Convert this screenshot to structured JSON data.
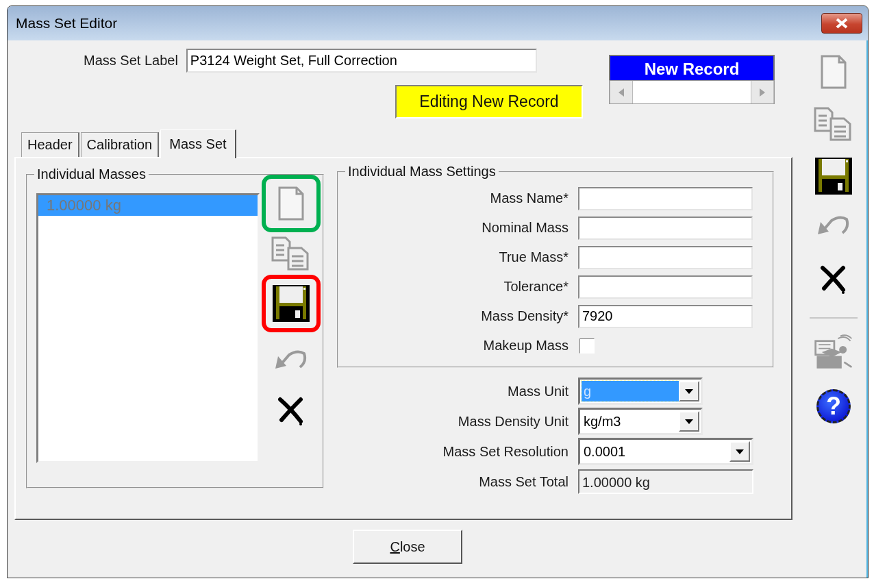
{
  "window": {
    "title": "Mass Set Editor"
  },
  "mass_set_label": {
    "label": "Mass Set Label",
    "value": "P3124 Weight Set, Full Correction"
  },
  "edit_status": "Editing New Record",
  "record_navigator": {
    "label": "New Record"
  },
  "tabs": [
    {
      "label": "Header",
      "selected": false
    },
    {
      "label": "Calibration",
      "selected": false
    },
    {
      "label": "Mass Set",
      "selected": true
    }
  ],
  "individual_masses": {
    "title": "Individual Masses",
    "items": [
      {
        "label": "1.00000 kg",
        "selected": true
      }
    ],
    "toolbar": [
      {
        "kind": "new",
        "disabled": true,
        "color": "#00b050"
      },
      {
        "kind": "copy",
        "disabled": true
      },
      {
        "kind": "save",
        "disabled": false,
        "color": "#ff0000"
      },
      {
        "kind": "undo",
        "disabled": true
      },
      {
        "kind": "delete",
        "disabled": false
      }
    ]
  },
  "individual_mass_settings": {
    "title": "Individual Mass Settings",
    "fields": [
      {
        "kind": "text",
        "label": "Mass Name*"
      },
      {
        "kind": "text",
        "label": "Nominal Mass"
      },
      {
        "kind": "text",
        "label": "True Mass*"
      },
      {
        "kind": "text",
        "label": "Tolerance*"
      },
      {
        "kind": "text",
        "label": "Mass Density*",
        "value": "7920"
      },
      {
        "kind": "checkbox",
        "label": "Makeup Mass",
        "checked": false
      }
    ]
  },
  "set_fields": [
    {
      "kind": "select",
      "label": "Mass Unit",
      "value": "g",
      "focused": true,
      "wide": false
    },
    {
      "kind": "select",
      "label": "Mass Density Unit",
      "value": "kg/m3",
      "focused": false,
      "wide": false
    },
    {
      "kind": "select",
      "label": "Mass Set Resolution",
      "value": "0.0001",
      "focused": false,
      "wide": true
    },
    {
      "kind": "readonly",
      "label": "Mass Set Total",
      "value": "1.00000 kg"
    }
  ],
  "side_toolbar": [
    {
      "kind": "new",
      "disabled": true
    },
    {
      "kind": "copy",
      "disabled": true
    },
    {
      "kind": "save",
      "disabled": false
    },
    {
      "kind": "undo",
      "disabled": true
    },
    {
      "kind": "delete",
      "disabled": false
    },
    {
      "kind": "separator"
    },
    {
      "kind": "tool",
      "disabled": true
    },
    {
      "kind": "help",
      "disabled": false,
      "glyph": "?"
    }
  ],
  "close_button": {
    "label": "Close",
    "first_letter_underlined": true
  }
}
